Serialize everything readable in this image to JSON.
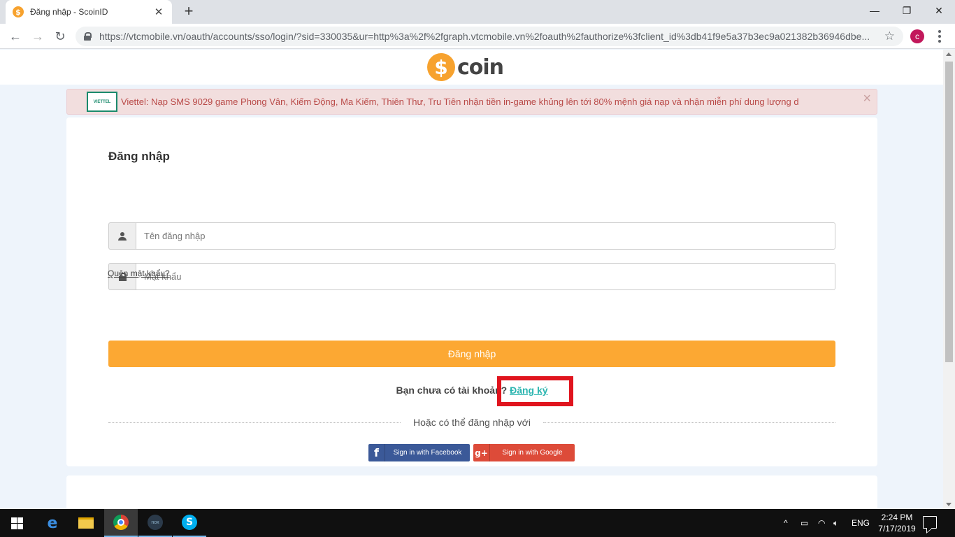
{
  "browser": {
    "tab_title": "Đăng nhập - ScoinID",
    "tab_favicon": "$",
    "url": "https://vtcmobile.vn/oauth/accounts/sso/login/?sid=330035&ur=http%3a%2f%2fgraph.vtcmobile.vn%2foauth%2fauthorize%3fclient_id%3db41f9e5a37b3ec9a021382b36946dbe...",
    "profile_initial": "c"
  },
  "site": {
    "logo_symbol": "$",
    "logo_text": "coin"
  },
  "alert": {
    "operator_logo_text": "VIETTEL",
    "text": "Viettel: Nạp SMS 9029 game Phong Vân, Kiếm Động, Ma Kiếm, Thiên Thư, Tru Tiên nhận tiền in-game khủng lên tới 80% mệnh giá nạp và nhận miễn phí dung lượng d",
    "close": "×"
  },
  "login": {
    "title": "Đăng nhập",
    "username_placeholder": "Tên đăng nhập",
    "password_placeholder": "Mật khẩu",
    "forgot": "Quên mật khẩu?",
    "submit": "Đăng nhập",
    "no_account": "Bạn chưa có tài khoản?",
    "register": "Đăng ký",
    "or_text": "Hoặc có thể đăng nhập với",
    "facebook_icon": "f",
    "facebook": "Sign in with Facebook",
    "google_icon": "g+",
    "google": "Sign in with Google"
  },
  "taskbar": {
    "nox_label": "nox",
    "skype_icon": "S",
    "language": "ENG",
    "time": "2:24 PM",
    "date": "7/17/2019"
  },
  "colors": {
    "accent_orange": "#fca833",
    "link_teal": "#2bb5b0",
    "highlight_red": "#e0141e",
    "facebook_blue": "#3b5998",
    "google_red": "#dd4b39"
  }
}
